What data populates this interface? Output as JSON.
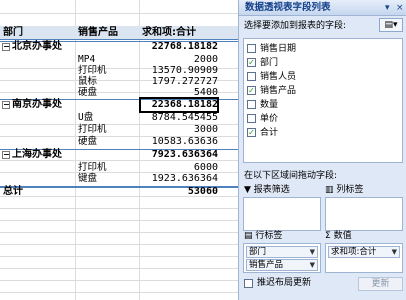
{
  "pivot": {
    "headers": {
      "col1": "部门",
      "col2": "销售产品",
      "col3": "求和项:合计"
    },
    "groups": [
      {
        "name": "北京办事处",
        "total": "22768.18182",
        "items": [
          {
            "product": "MP4",
            "value": "2000"
          },
          {
            "product": "打印机",
            "value": "13570.90909"
          },
          {
            "product": "鼠标",
            "value": "1797.272727"
          },
          {
            "product": "硬盘",
            "value": "5400"
          }
        ]
      },
      {
        "name": "南京办事处",
        "total": "22368.18182",
        "items": [
          {
            "product": "U盘",
            "value": "8784.545455"
          },
          {
            "product": "打印机",
            "value": "3000"
          },
          {
            "product": "硬盘",
            "value": "10583.63636"
          }
        ]
      },
      {
        "name": "上海办事处",
        "total": "7923.636364",
        "items": [
          {
            "product": "打印机",
            "value": "6000"
          },
          {
            "product": "键盘",
            "value": "1923.636364"
          }
        ]
      }
    ],
    "grand_total_label": "总计",
    "grand_total_value": "53060"
  },
  "panel": {
    "title": "数据透视表字段列表",
    "choose_fields_label": "选择要添加到报表的字段:",
    "fields": [
      {
        "label": "销售日期",
        "checked": false
      },
      {
        "label": "部门",
        "checked": true
      },
      {
        "label": "销售人员",
        "checked": false
      },
      {
        "label": "销售产品",
        "checked": true
      },
      {
        "label": "数量",
        "checked": false
      },
      {
        "label": "单价",
        "checked": false
      },
      {
        "label": "合计",
        "checked": true
      }
    ],
    "drag_label": "在以下区域间拖动字段:",
    "zones": {
      "report_filter": "报表筛选",
      "column_labels": "列标签",
      "row_labels": "行标签",
      "values": "数值"
    },
    "row_chips": [
      "部门",
      "销售产品"
    ],
    "value_chips": [
      "求和项:合计"
    ],
    "defer_label": "推迟布局更新",
    "update_label": "更新"
  }
}
